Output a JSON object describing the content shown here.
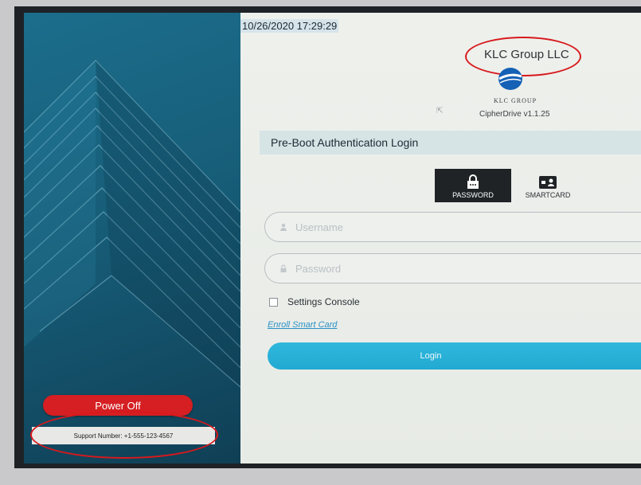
{
  "left": {
    "power_label": "Power Off",
    "support_text": "Support Number: +1-555-123-4567"
  },
  "header": {
    "timestamp": "10/26/2020 17:29:29",
    "company": "KLC Group LLC",
    "logo_text": "KLC GROUP",
    "version": "CipherDrive v1.1.25"
  },
  "form": {
    "title": "Pre-Boot Authentication Login",
    "tabs": [
      {
        "label": "PASSWORD",
        "icon": "password-icon",
        "active": true
      },
      {
        "label": "SMARTCARD",
        "icon": "smartcard-icon",
        "active": false
      }
    ],
    "username_placeholder": "Username",
    "password_placeholder": "Password",
    "settings_label": "Settings Console",
    "enroll_label": "Enroll Smart Card",
    "login_label": "Login"
  },
  "colors": {
    "accent": "#22a9d2",
    "power": "#d51f22",
    "annotation": "#d8191c",
    "left_panel": "#175d78"
  }
}
